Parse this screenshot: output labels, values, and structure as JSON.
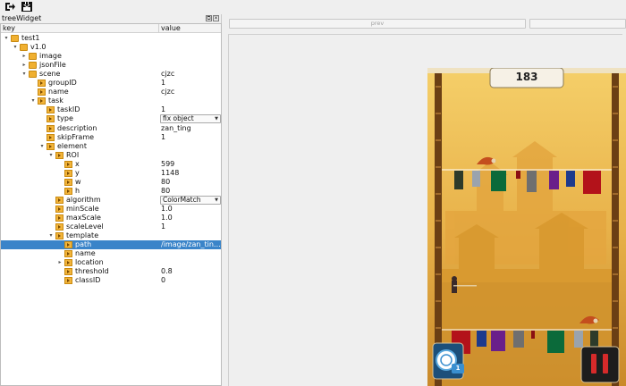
{
  "toolbar": {
    "open_icon": "open-icon",
    "save_icon": "save-icon"
  },
  "dock": {
    "title": "treeWidget",
    "buttons": [
      "⧉",
      "✕"
    ]
  },
  "tree": {
    "columns": {
      "key": "key",
      "value": "value"
    },
    "rows": [
      {
        "key": "test1",
        "value": "",
        "depth": 0,
        "kind": "folder",
        "arrow": "open"
      },
      {
        "key": "v1.0",
        "value": "",
        "depth": 1,
        "kind": "folder",
        "arrow": "open"
      },
      {
        "key": "image",
        "value": "",
        "depth": 2,
        "kind": "folder",
        "arrow": "closed"
      },
      {
        "key": "jsonFile",
        "value": "",
        "depth": 2,
        "kind": "folder",
        "arrow": "closed"
      },
      {
        "key": "scene",
        "value": "cjzc",
        "depth": 2,
        "kind": "folder",
        "arrow": "open"
      },
      {
        "key": "groupID",
        "value": "1",
        "depth": 3,
        "kind": "leaf",
        "arrow": "none"
      },
      {
        "key": "name",
        "value": "cjzc",
        "depth": 3,
        "kind": "leaf",
        "arrow": "none"
      },
      {
        "key": "task",
        "value": "",
        "depth": 3,
        "kind": "leaf",
        "arrow": "open"
      },
      {
        "key": "taskID",
        "value": "1",
        "depth": 4,
        "kind": "leaf",
        "arrow": "none"
      },
      {
        "key": "type",
        "value": "fix object",
        "depth": 4,
        "kind": "leaf",
        "arrow": "none",
        "combo": true
      },
      {
        "key": "description",
        "value": "zan_ting",
        "depth": 4,
        "kind": "leaf",
        "arrow": "none"
      },
      {
        "key": "skipFrame",
        "value": "1",
        "depth": 4,
        "kind": "leaf",
        "arrow": "none"
      },
      {
        "key": "element",
        "value": "",
        "depth": 4,
        "kind": "leaf",
        "arrow": "open"
      },
      {
        "key": "ROI",
        "value": "",
        "depth": 5,
        "kind": "leaf",
        "arrow": "open"
      },
      {
        "key": "x",
        "value": "599",
        "depth": 6,
        "kind": "leaf",
        "arrow": "none"
      },
      {
        "key": "y",
        "value": "1148",
        "depth": 6,
        "kind": "leaf",
        "arrow": "none"
      },
      {
        "key": "w",
        "value": "80",
        "depth": 6,
        "kind": "leaf",
        "arrow": "none"
      },
      {
        "key": "h",
        "value": "80",
        "depth": 6,
        "kind": "leaf",
        "arrow": "none"
      },
      {
        "key": "algorithm",
        "value": "ColorMatch",
        "depth": 5,
        "kind": "leaf",
        "arrow": "none",
        "combo": true
      },
      {
        "key": "minScale",
        "value": "1.0",
        "depth": 5,
        "kind": "leaf",
        "arrow": "none"
      },
      {
        "key": "maxScale",
        "value": "1.0",
        "depth": 5,
        "kind": "leaf",
        "arrow": "none"
      },
      {
        "key": "scaleLevel",
        "value": "1",
        "depth": 5,
        "kind": "leaf",
        "arrow": "none"
      },
      {
        "key": "template",
        "value": "",
        "depth": 5,
        "kind": "leaf",
        "arrow": "open"
      },
      {
        "key": "path",
        "value": "/image/zan_ting...",
        "depth": 6,
        "kind": "leaf",
        "arrow": "none",
        "selected": true
      },
      {
        "key": "name",
        "value": "",
        "depth": 6,
        "kind": "leaf",
        "arrow": "none"
      },
      {
        "key": "location",
        "value": "",
        "depth": 6,
        "kind": "leaf",
        "arrow": "closed"
      },
      {
        "key": "threshold",
        "value": "0.8",
        "depth": 6,
        "kind": "leaf",
        "arrow": "none"
      },
      {
        "key": "classID",
        "value": "0",
        "depth": 6,
        "kind": "leaf",
        "arrow": "none"
      }
    ]
  },
  "main": {
    "prev_label": "prev",
    "next_label": ""
  },
  "game": {
    "score": "183",
    "powerup_count": "1",
    "colors": {
      "sky": "#f2c35a",
      "wall": "#d9a23f",
      "pole": "#6b3f14",
      "rope": "#ffffff",
      "panel": "#1c4f7a"
    }
  }
}
